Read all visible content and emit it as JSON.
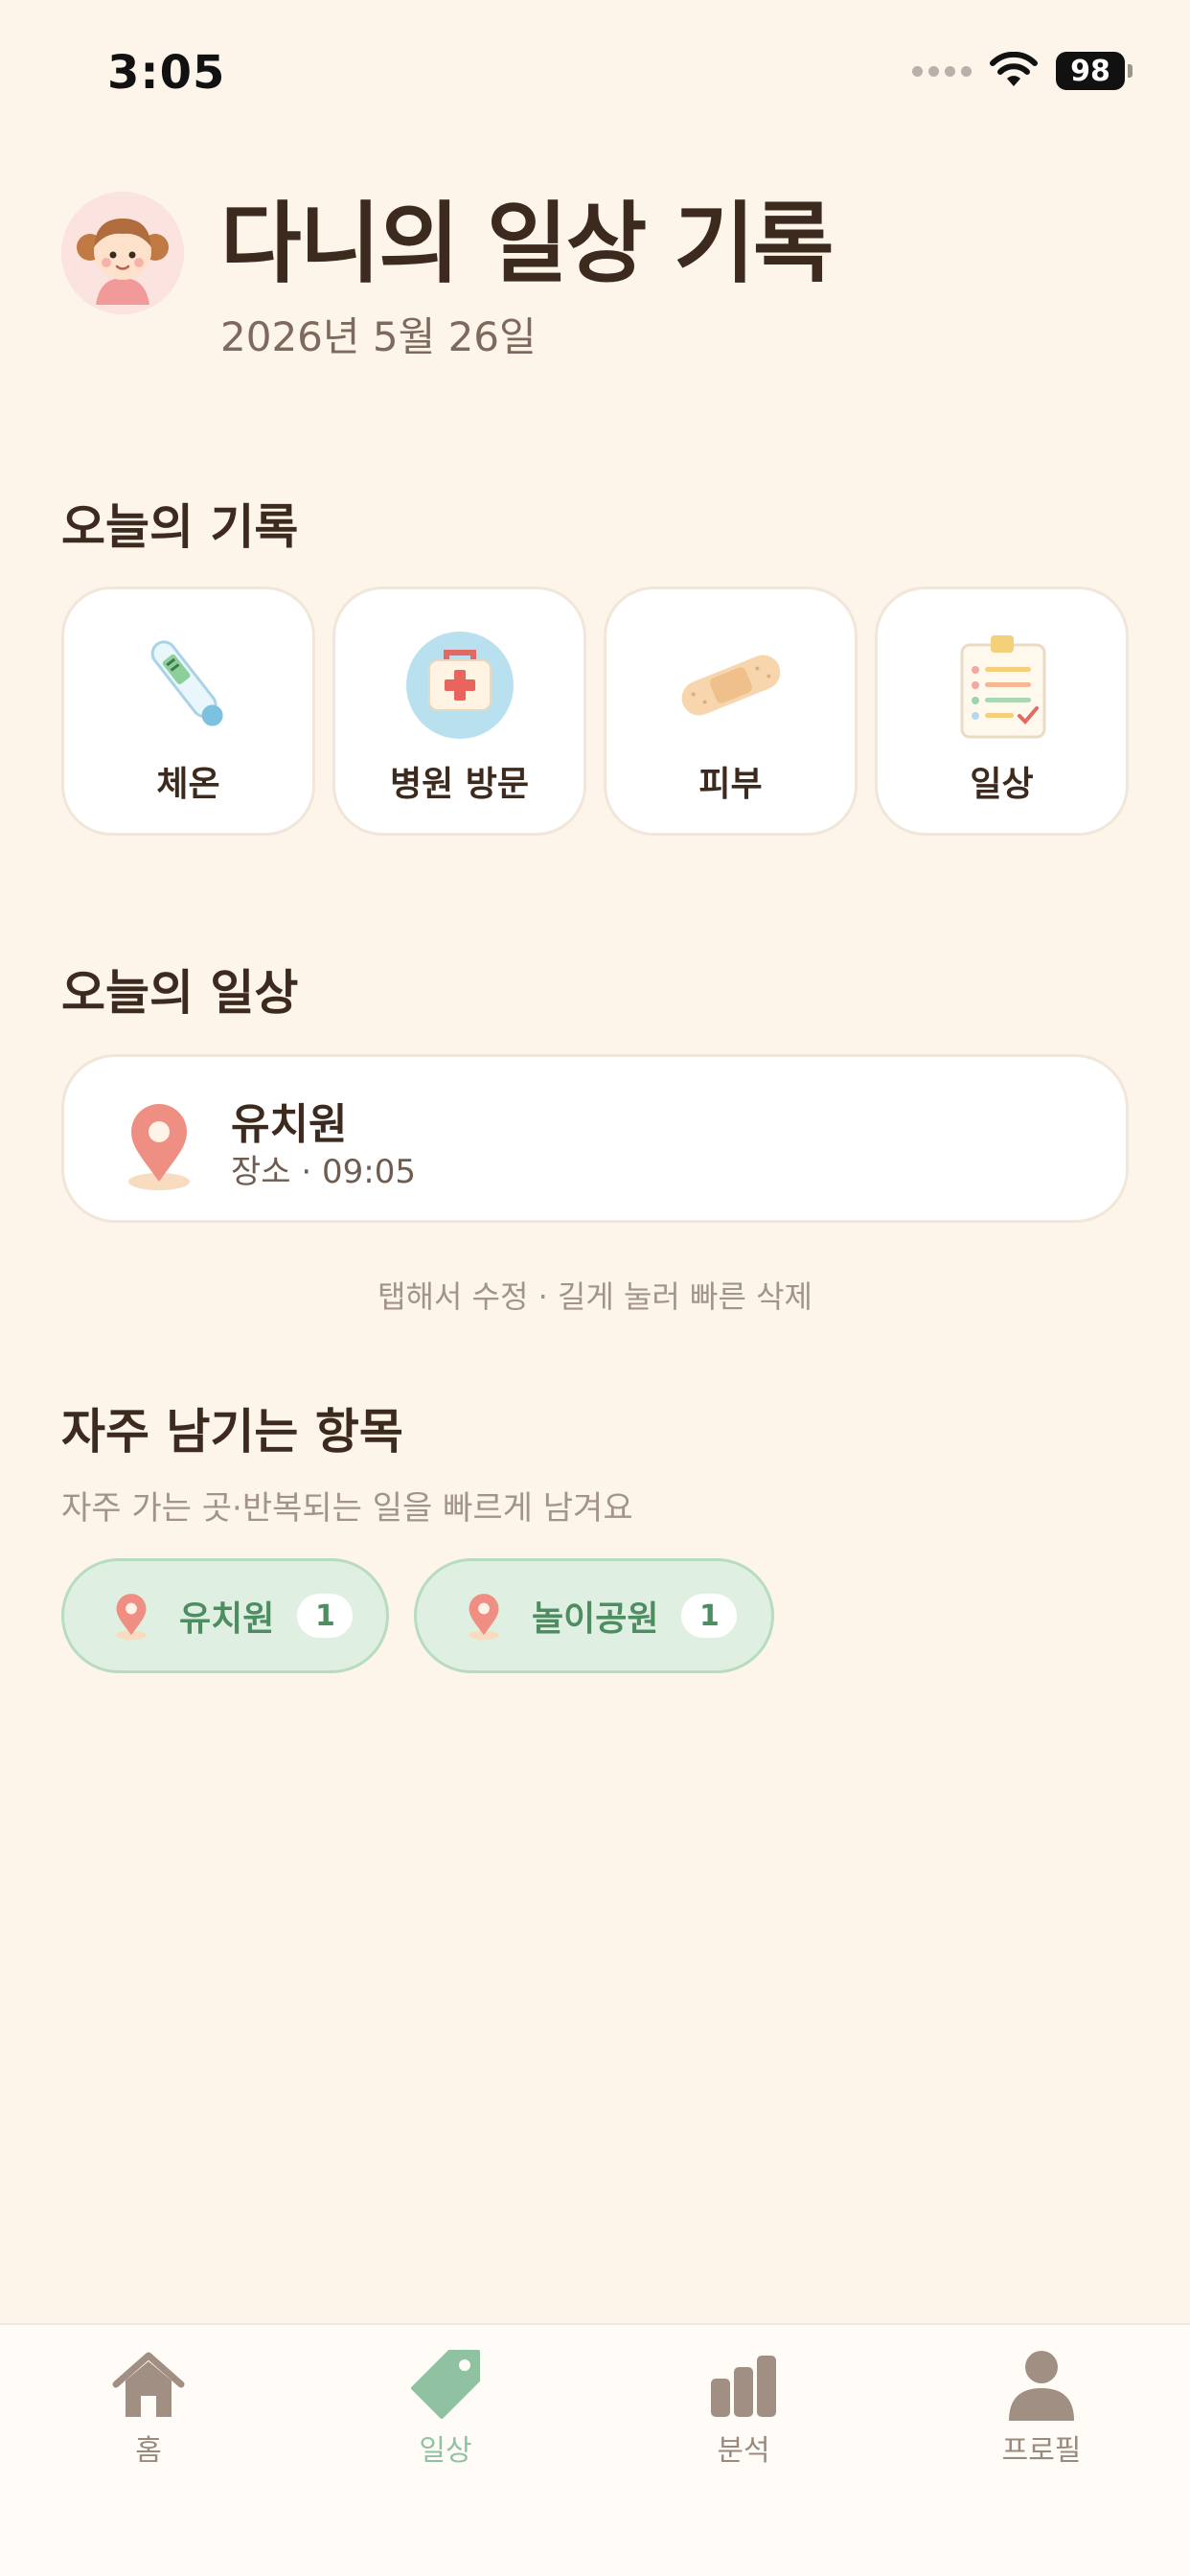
{
  "status_bar": {
    "time": "3:05",
    "battery": "98"
  },
  "header": {
    "title": "다니의 일상 기록",
    "date": "2026년 5월 26일"
  },
  "today_records": {
    "title": "오늘의 기록",
    "items": [
      {
        "label": "체온",
        "icon": "thermometer-icon"
      },
      {
        "label": "병원 방문",
        "icon": "first-aid-kit-icon"
      },
      {
        "label": "피부",
        "icon": "bandage-icon"
      },
      {
        "label": "일상",
        "icon": "clipboard-checklist-icon"
      }
    ]
  },
  "today_daily": {
    "title": "오늘의 일상",
    "entries": [
      {
        "name": "유치원",
        "meta": "장소 · 09:05",
        "icon": "location-pin-icon"
      }
    ],
    "hint": "탭해서 수정 · 길게 눌러 빠른 삭제"
  },
  "favorites": {
    "title": "자주 남기는 항목",
    "subtitle": "자주 가는 곳·반복되는 일을 빠르게 남겨요",
    "chips": [
      {
        "label": "유치원",
        "count": "1"
      },
      {
        "label": "놀이공원",
        "count": "1"
      }
    ]
  },
  "tab_bar": {
    "active": "일상",
    "tabs": [
      {
        "label": "홈",
        "icon": "home-icon"
      },
      {
        "label": "일상",
        "icon": "tag-icon"
      },
      {
        "label": "분석",
        "icon": "bar-chart-icon"
      },
      {
        "label": "프로필",
        "icon": "person-icon"
      }
    ]
  },
  "colors": {
    "background": "#fdf4ea",
    "text_primary": "#3d2a1e",
    "accent_green": "#8fc2a0",
    "chip_background": "#dff0e2"
  }
}
